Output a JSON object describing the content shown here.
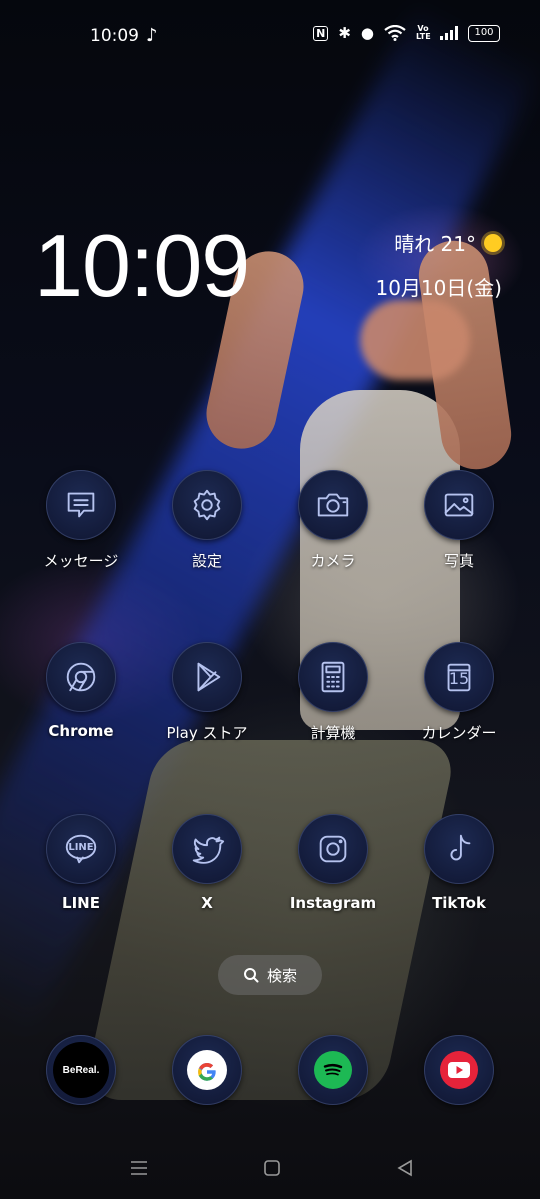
{
  "status_bar": {
    "time": "10:09",
    "battery": "100",
    "volte": "Vo LTE"
  },
  "clock_widget": {
    "time": "10:09",
    "weather": "晴れ 21°",
    "date": "10月10日(金)"
  },
  "apps": [
    {
      "label": "メッセージ",
      "icon": "message-icon"
    },
    {
      "label": "設定",
      "icon": "gear-icon"
    },
    {
      "label": "カメラ",
      "icon": "camera-icon"
    },
    {
      "label": "写真",
      "icon": "photo-icon"
    },
    {
      "label": "Chrome",
      "icon": "chrome-icon"
    },
    {
      "label": "Play ストア",
      "icon": "play-store-icon"
    },
    {
      "label": "計算機",
      "icon": "calculator-icon"
    },
    {
      "label": "カレンダー",
      "icon": "calendar-icon",
      "calendar_day": "15"
    },
    {
      "label": "LINE",
      "icon": "line-icon",
      "badge_text": "LINE"
    },
    {
      "label": "X",
      "icon": "twitter-bird-icon"
    },
    {
      "label": "Instagram",
      "icon": "instagram-icon"
    },
    {
      "label": "TikTok",
      "icon": "tiktok-icon"
    }
  ],
  "search": {
    "label": "検索"
  },
  "dock": [
    {
      "icon": "bereal-icon",
      "text": "BeReal."
    },
    {
      "icon": "google-icon",
      "text": "G"
    },
    {
      "icon": "spotify-icon"
    },
    {
      "icon": "youtube-icon"
    }
  ],
  "colors": {
    "icon_bg": "#131b3a",
    "icon_glyph": "#b6c3ef",
    "spotify": "#1db954",
    "youtube": "#e6233a",
    "sun": "#ffcc22"
  }
}
